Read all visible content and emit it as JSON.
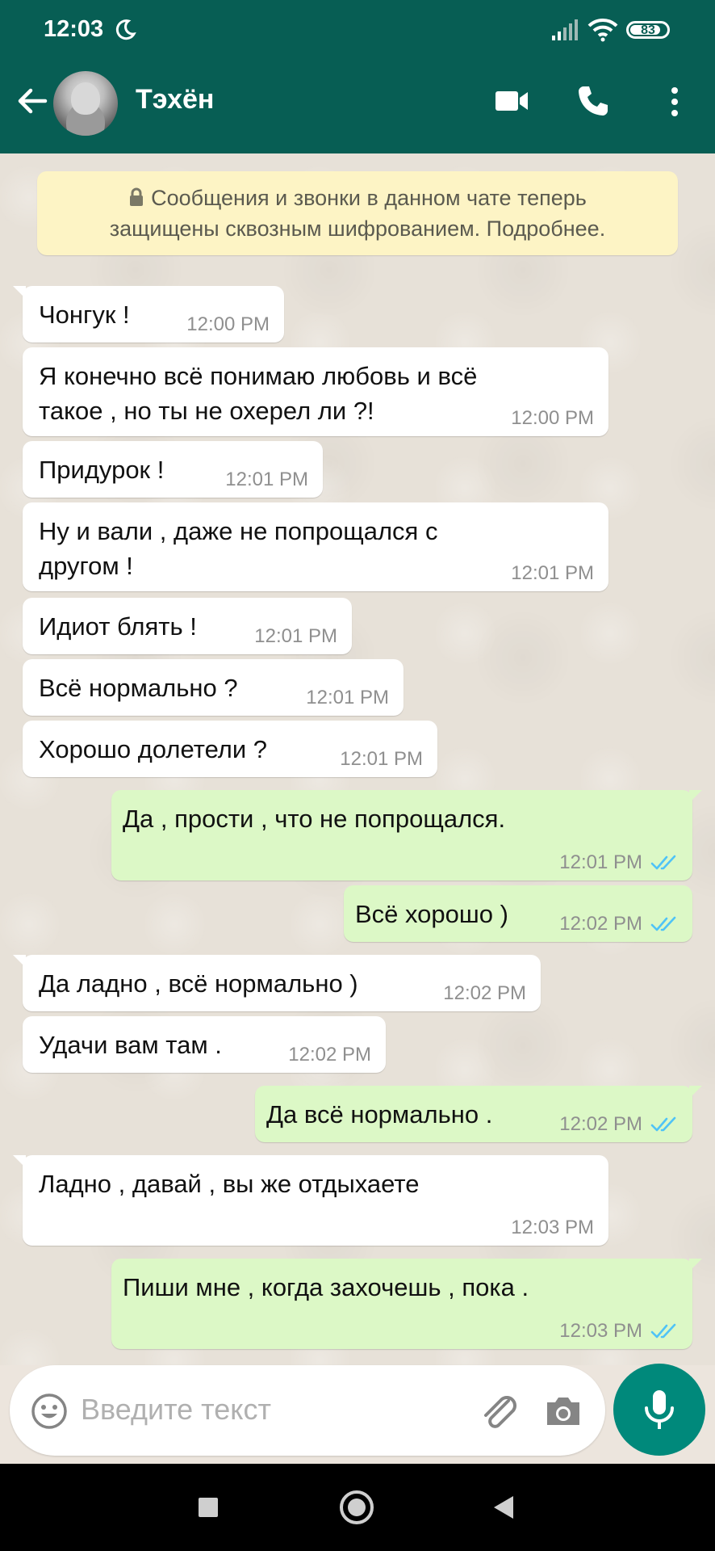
{
  "status_bar": {
    "time": "12:03",
    "battery": "83"
  },
  "header": {
    "contact_name": "Тэхён"
  },
  "encryption_notice": {
    "line1": "Сообщения и звонки в данном чате теперь",
    "line2": "защищены сквозным шифрованием. Подробнее."
  },
  "messages": [
    {
      "dir": "in",
      "lines": [
        "Чонгук !"
      ],
      "time": "12:00 PM"
    },
    {
      "dir": "in",
      "lines": [
        "Я конечно всё понимаю любовь и всё",
        "такое , но ты не охерел ли ?!"
      ],
      "time": "12:00 PM"
    },
    {
      "dir": "in",
      "lines": [
        "Придурок !"
      ],
      "time": "12:01 PM"
    },
    {
      "dir": "in",
      "lines": [
        "Ну и вали , даже не попрощался с",
        "другом !"
      ],
      "time": "12:01 PM"
    },
    {
      "dir": "in",
      "lines": [
        "Идиот блять !"
      ],
      "time": "12:01 PM"
    },
    {
      "dir": "in",
      "lines": [
        "Всё нормально ?"
      ],
      "time": "12:01 PM"
    },
    {
      "dir": "in",
      "lines": [
        "Хорошо долетели ?"
      ],
      "time": "12:01 PM"
    },
    {
      "dir": "out",
      "lines": [
        "Да , прости , что не попрощался."
      ],
      "time": "12:01 PM",
      "read": true
    },
    {
      "dir": "out",
      "lines": [
        "Всё хорошо )"
      ],
      "time": "12:02 PM",
      "read": true
    },
    {
      "dir": "in",
      "lines": [
        "Да ладно , всё нормально )"
      ],
      "time": "12:02 PM"
    },
    {
      "dir": "in",
      "lines": [
        "Удачи вам там ."
      ],
      "time": "12:02 PM"
    },
    {
      "dir": "out",
      "lines": [
        "Да всё нормально ."
      ],
      "time": "12:02 PM",
      "read": true
    },
    {
      "dir": "in",
      "lines": [
        "Ладно , давай , вы же отдыхаете"
      ],
      "time": "12:03 PM"
    },
    {
      "dir": "out",
      "lines": [
        "Пиши мне , когда захочешь , пока ."
      ],
      "time": "12:03 PM",
      "read": true
    }
  ],
  "composer": {
    "placeholder": "Введите текст"
  },
  "colors": {
    "header": "#075e54",
    "outgoing_bubble": "#dcf8c6",
    "incoming_bubble": "#ffffff",
    "read_ticks": "#4fc3f7",
    "mic_button": "#00897b"
  }
}
